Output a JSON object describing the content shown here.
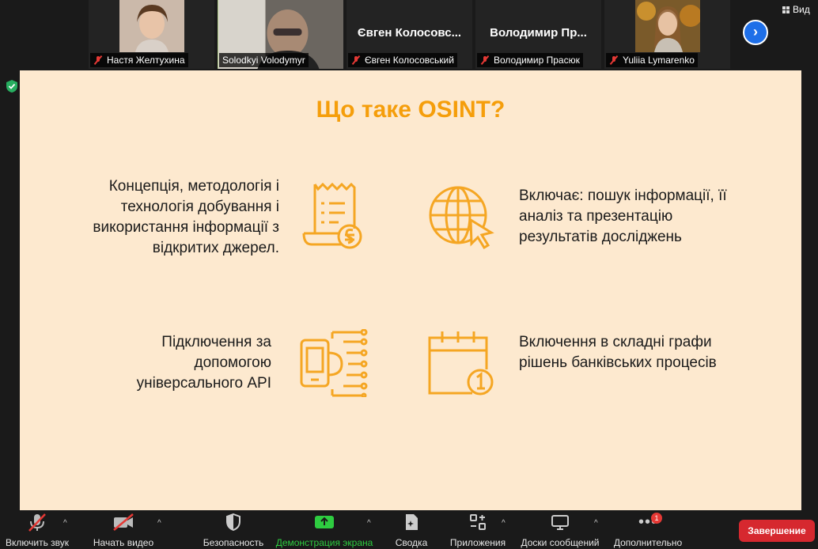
{
  "participants": [
    {
      "name": "Настя Желтухина",
      "muted": true,
      "has_video": true
    },
    {
      "name": "Solodkyi Volodymyr",
      "muted": false,
      "has_video": true,
      "active": true
    },
    {
      "name": "Євген Колосовський",
      "display": "Євген  Колосовс...",
      "muted": true,
      "has_video": false
    },
    {
      "name": "Володимир Прасюк",
      "display": "Володимир  Пр...",
      "muted": true,
      "has_video": false
    },
    {
      "name": "Yuliia Lymarenko",
      "muted": true,
      "has_video": true
    }
  ],
  "view_label": "Вид",
  "slide": {
    "title": "Що таке OSINT?",
    "items": [
      {
        "text": [
          "Концепція, методологія і",
          "технологія добування і",
          "використання інформації з",
          "відкритих джерел."
        ],
        "icon": "receipt-hryvnia-icon"
      },
      {
        "text": [
          "Включає: пошук інформації, її",
          "аналіз та презентацію",
          "результатів досліджень"
        ],
        "icon": "globe-cursor-icon"
      },
      {
        "text": [
          "Підключення за",
          "допомогою",
          "універсального API"
        ],
        "icon": "phone-circuit-icon"
      },
      {
        "text": [
          "Включення в складні графи",
          "рішень банківських процесів"
        ],
        "icon": "calendar-clock-icon"
      }
    ]
  },
  "toolbar": {
    "mute": "Включить звук",
    "video": "Начать видео",
    "security": "Безопасность",
    "share": "Демонстрация экрана",
    "summary": "Сводка",
    "apps": "Приложения",
    "whiteboards": "Доски сообщений",
    "more": "Дополнительно",
    "more_badge": "1",
    "end": "Завершение"
  },
  "colors": {
    "accent": "#f59e0b",
    "slide_bg": "#fde9cf",
    "share_green": "#2ecc40",
    "end_red": "#d6282f",
    "link_blue": "#1e6fe8"
  }
}
